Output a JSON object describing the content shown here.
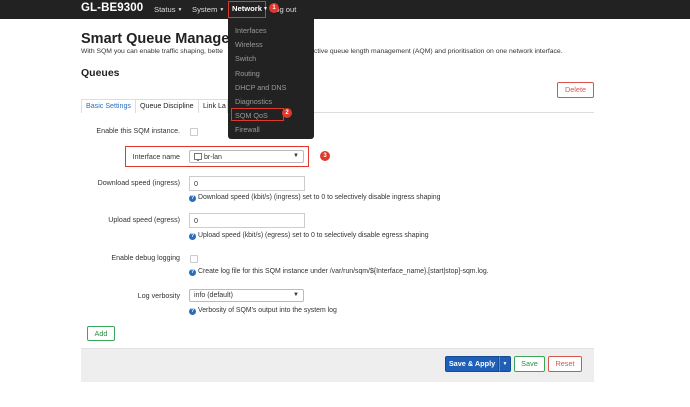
{
  "nav": {
    "brand": "GL-BE9300",
    "status": "Status",
    "system": "System",
    "network": "Network",
    "logout": "Log out",
    "caret": "▼"
  },
  "network_menu": {
    "items": [
      "Interfaces",
      "Wireless",
      "Switch",
      "Routing",
      "DHCP and DNS",
      "Diagnostics",
      "SQM QoS",
      "Firewall"
    ]
  },
  "annotations": [
    "1",
    "2",
    "3"
  ],
  "page": {
    "title": "Smart Queue Managem",
    "description_left": "With SQM you can enable traffic shaping, bette",
    "description_right": "ctive queue length management (AQM) and prioritisation on one network interface.",
    "section_title": "Queues",
    "delete_label": "Delete"
  },
  "tabs": [
    "Basic Settings",
    "Queue Discipline",
    "Link La"
  ],
  "form": {
    "enable_label": "Enable this SQM instance.",
    "interface_label": "Interface name",
    "interface_value": "br-lan",
    "download_label": "Download speed (ingress)",
    "download_value": "0",
    "download_help": "Download speed (kbit/s) (ingress) set to 0 to selectively disable ingress shaping",
    "upload_label": "Upload speed (egress)",
    "upload_value": "0",
    "upload_help": "Upload speed (kbit/s) (egress) set to 0 to selectively disable egress shaping",
    "debug_label": "Enable debug logging",
    "debug_help": "Create log file for this SQM instance under /var/run/sqm/${Interface_name}.[start|stop]-sqm.log.",
    "verbosity_label": "Log verbosity",
    "verbosity_value": "info (default)",
    "verbosity_help": "Verbosity of SQM's output into the system log",
    "help_glyph": "?"
  },
  "buttons": {
    "add": "Add",
    "save_apply": "Save & Apply",
    "save": "Save",
    "reset": "Reset"
  },
  "colors": {
    "accent": "#1e5fb8",
    "highlight": "#e0392b",
    "success": "#3aa657",
    "danger": "#d9534f"
  }
}
